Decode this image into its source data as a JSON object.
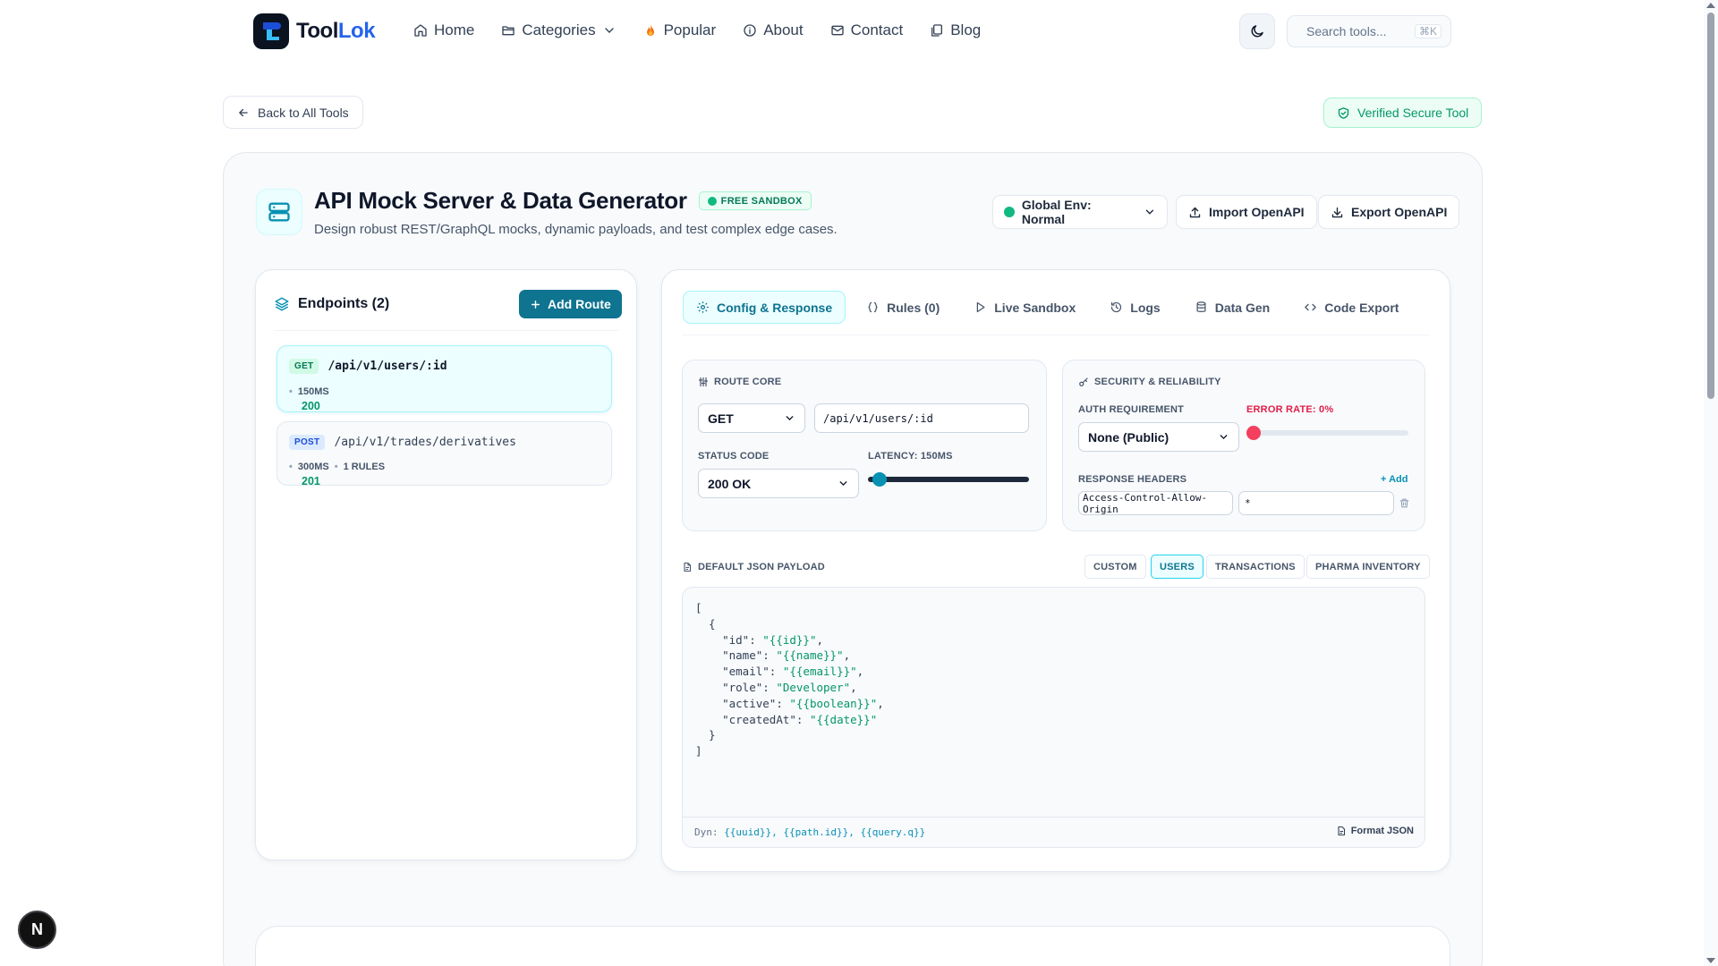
{
  "nav": {
    "brand_first": "Tool",
    "brand_second": "Lok",
    "links": [
      {
        "label": "Home",
        "icon": "home-icon"
      },
      {
        "label": "Categories",
        "icon": "folder-icon"
      },
      {
        "label": "Popular",
        "icon": "flame-icon"
      },
      {
        "label": "About",
        "icon": "info-icon"
      },
      {
        "label": "Contact",
        "icon": "mail-icon"
      },
      {
        "label": "Blog",
        "icon": "document-icon"
      }
    ],
    "search_placeholder": "Search tools...",
    "search_shortcut": "⌘K"
  },
  "subbar": {
    "back_label": "Back to All Tools",
    "verified_label": "Verified Secure Tool"
  },
  "tool": {
    "title": "API Mock Server & Data Generator",
    "badge": "FREE SANDBOX",
    "subtitle": "Design robust REST/GraphQL mocks, dynamic payloads, and test complex edge cases.",
    "env_label": "Global Env: Normal",
    "import_label": "Import OpenAPI",
    "export_label": "Export OpenAPI"
  },
  "endpoints": {
    "header": "Endpoints (2)",
    "add_label": "Add Route",
    "items": [
      {
        "method": "GET",
        "path": "/api/v1/users/:id",
        "status": "200",
        "latency": "150MS",
        "rules": ""
      },
      {
        "method": "POST",
        "path": "/api/v1/trades/derivatives",
        "status": "201",
        "latency": "300MS",
        "rules": "1 RULES"
      }
    ]
  },
  "editor": {
    "tabs": [
      {
        "label": "Config & Response",
        "icon": "gear-icon"
      },
      {
        "label": "Rules (0)",
        "icon": "braces-icon"
      },
      {
        "label": "Live Sandbox",
        "icon": "play-icon"
      },
      {
        "label": "Logs",
        "icon": "history-icon"
      },
      {
        "label": "Data Gen",
        "icon": "database-icon"
      },
      {
        "label": "Code Export",
        "icon": "code-icon"
      }
    ],
    "route_core": {
      "title": "ROUTE CORE",
      "method": "GET",
      "path": "/api/v1/users/:id",
      "status_label": "STATUS CODE",
      "status_value": "200 OK",
      "latency_label": "LATENCY: 150MS",
      "latency_fraction": 0.03
    },
    "security": {
      "title": "SECURITY & RELIABILITY",
      "auth_label": "AUTH REQUIREMENT",
      "auth_value": "None (Public)",
      "error_label": "ERROR RATE: 0%",
      "error_fraction": 0,
      "headers_label": "RESPONSE HEADERS",
      "add_label": "+ Add",
      "header_key": "Access-Control-Allow-Origin",
      "header_value": "*"
    },
    "payload": {
      "label": "DEFAULT JSON PAYLOAD",
      "presets": [
        "CUSTOM",
        "USERS",
        "TRANSACTIONS",
        "PHARMA INVENTORY"
      ],
      "active_preset": "USERS",
      "lines": [
        "[",
        "  {",
        "    \"id\": \"{{id}}\",",
        "    \"name\": \"{{name}}\",",
        "    \"email\": \"{{email}}\",",
        "    \"role\": \"Developer\",",
        "    \"active\": \"{{boolean}}\",",
        "    \"createdAt\": \"{{date}}\"",
        "  }",
        "]"
      ],
      "dyn_prefix": "Dyn:",
      "dyn_vars": "{{uuid}}, {{path.id}}, {{query.q}}",
      "format_label": "Format JSON"
    }
  },
  "colors": {
    "accent": "#0e7490",
    "brand_blue": "#2563eb",
    "success": "#059669",
    "danger": "#e11d48"
  }
}
